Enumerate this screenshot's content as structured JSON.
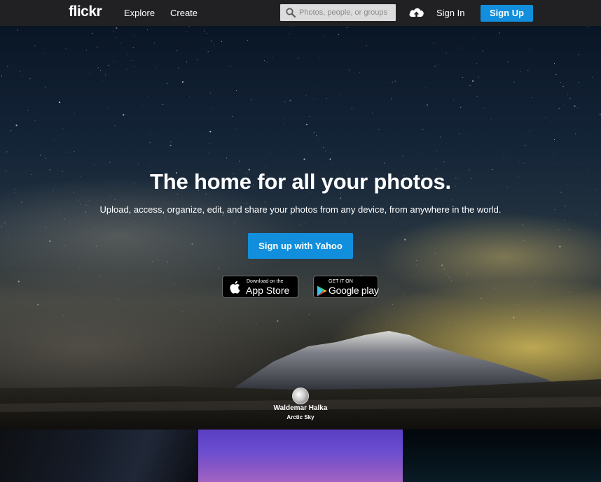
{
  "nav": {
    "logo": "flickr",
    "explore": "Explore",
    "create": "Create",
    "search_placeholder": "Photos, people, or groups",
    "upload_icon": "cloud-upload-icon",
    "sign_in": "Sign In",
    "sign_up": "Sign Up"
  },
  "hero": {
    "title": "The home for all your photos.",
    "subtitle": "Upload, access, organize, edit, and share your photos from any device, from anywhere in the world.",
    "cta": "Sign up with Yahoo",
    "app_store": {
      "small": "Download on the",
      "big": "App Store"
    },
    "google_play": {
      "small": "GET IT ON",
      "big": "Google play"
    },
    "credit": {
      "name": "Waldemar Halka",
      "title": "Arctic Sky"
    }
  },
  "colors": {
    "accent": "#128fdc",
    "nav_bg": "#212124"
  }
}
